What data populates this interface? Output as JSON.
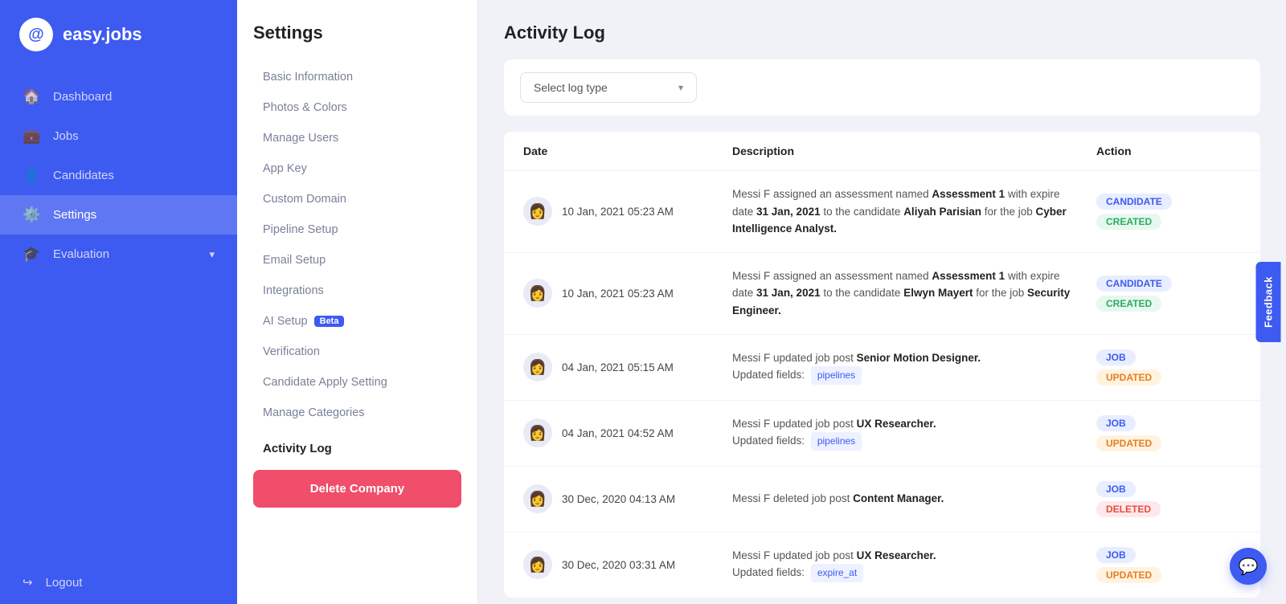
{
  "sidebar": {
    "logo_text": "easy.jobs",
    "logo_icon": "🔍",
    "nav_items": [
      {
        "id": "dashboard",
        "label": "Dashboard",
        "icon": "🏠",
        "active": false
      },
      {
        "id": "jobs",
        "label": "Jobs",
        "icon": "💼",
        "active": false
      },
      {
        "id": "candidates",
        "label": "Candidates",
        "icon": "👤",
        "active": false
      },
      {
        "id": "settings",
        "label": "Settings",
        "icon": "⚙️",
        "active": true
      },
      {
        "id": "evaluation",
        "label": "Evaluation",
        "icon": "🎓",
        "active": false,
        "arrow": "▾"
      }
    ],
    "logout_label": "Logout",
    "logout_icon": "↪"
  },
  "settings": {
    "title": "Settings",
    "menu_items": [
      {
        "id": "basic-info",
        "label": "Basic Information",
        "active": false
      },
      {
        "id": "photos-colors",
        "label": "Photos & Colors",
        "active": false
      },
      {
        "id": "manage-users",
        "label": "Manage Users",
        "active": false
      },
      {
        "id": "app-key",
        "label": "App Key",
        "active": false
      },
      {
        "id": "custom-domain",
        "label": "Custom Domain",
        "active": false
      },
      {
        "id": "pipeline-setup",
        "label": "Pipeline Setup",
        "active": false
      },
      {
        "id": "email-setup",
        "label": "Email Setup",
        "active": false
      },
      {
        "id": "integrations",
        "label": "Integrations",
        "active": false
      },
      {
        "id": "ai-setup",
        "label": "AI Setup",
        "badge": "Beta",
        "active": false
      },
      {
        "id": "verification",
        "label": "Verification",
        "active": false
      },
      {
        "id": "candidate-apply",
        "label": "Candidate Apply Setting",
        "active": false
      },
      {
        "id": "manage-categories",
        "label": "Manage Categories",
        "active": false
      }
    ],
    "activity_log_label": "Activity Log",
    "delete_company_label": "Delete Company"
  },
  "activity_log": {
    "title": "Activity Log",
    "filter_placeholder": "Select log type",
    "columns": {
      "date": "Date",
      "description": "Description",
      "action": "Action"
    },
    "rows": [
      {
        "date": "10 Jan, 2021 05:23 AM",
        "description_parts": [
          {
            "type": "normal",
            "text": "Messi F assigned an assessment named "
          },
          {
            "type": "bold",
            "text": "Assessment 1"
          },
          {
            "type": "normal",
            "text": " with expire date "
          },
          {
            "type": "bold",
            "text": "31 Jan, 2021"
          },
          {
            "type": "normal",
            "text": " to the candidate "
          },
          {
            "type": "bold",
            "text": "Aliyah Parisian"
          },
          {
            "type": "normal",
            "text": " for the job "
          },
          {
            "type": "bold",
            "text": "Cyber Intelligence Analyst."
          }
        ],
        "action_type": "CANDIDATE",
        "action_status": "created",
        "action_type_badge": "badge-candidate",
        "action_status_badge": "badge-created"
      },
      {
        "date": "10 Jan, 2021 05:23 AM",
        "description_parts": [
          {
            "type": "normal",
            "text": "Messi F assigned an assessment named "
          },
          {
            "type": "bold",
            "text": "Assessment 1"
          },
          {
            "type": "normal",
            "text": " with expire date "
          },
          {
            "type": "bold",
            "text": "31 Jan, 2021"
          },
          {
            "type": "normal",
            "text": " to the candidate "
          },
          {
            "type": "bold",
            "text": "Elwyn Mayert"
          },
          {
            "type": "normal",
            "text": " for the job "
          },
          {
            "type": "bold",
            "text": "Security Engineer."
          }
        ],
        "action_type": "CANDIDATE",
        "action_status": "created",
        "action_type_badge": "badge-candidate",
        "action_status_badge": "badge-created"
      },
      {
        "date": "04 Jan, 2021 05:15 AM",
        "description_plain": "Messi F updated job post ",
        "description_bold": "Senior Motion Designer.",
        "description_field_label": "Updated fields:",
        "description_tag": "pipelines",
        "action_type": "JOB",
        "action_status": "updated",
        "action_type_badge": "badge-job",
        "action_status_badge": "badge-updated"
      },
      {
        "date": "04 Jan, 2021 04:52 AM",
        "description_plain": "Messi F updated job post ",
        "description_bold": "UX Researcher.",
        "description_field_label": "Updated fields:",
        "description_tag": "pipelines",
        "action_type": "JOB",
        "action_status": "updated",
        "action_type_badge": "badge-job",
        "action_status_badge": "badge-updated"
      },
      {
        "date": "30 Dec, 2020 04:13 AM",
        "description_plain": "Messi F deleted job post ",
        "description_bold": "Content Manager.",
        "action_type": "JOB",
        "action_status": "deleted",
        "action_type_badge": "badge-job",
        "action_status_badge": "badge-deleted"
      },
      {
        "date": "30 Dec, 2020 03:31 AM",
        "description_plain": "Messi F updated job post ",
        "description_bold": "UX Researcher.",
        "description_field_label": "Updated fields:",
        "description_tag": "expire_at",
        "action_type": "JOB",
        "action_status": "updated",
        "action_type_badge": "badge-job",
        "action_status_badge": "badge-updated"
      }
    ]
  },
  "feedback": {
    "label": "Feedback"
  },
  "chat": {
    "icon": "💬"
  }
}
